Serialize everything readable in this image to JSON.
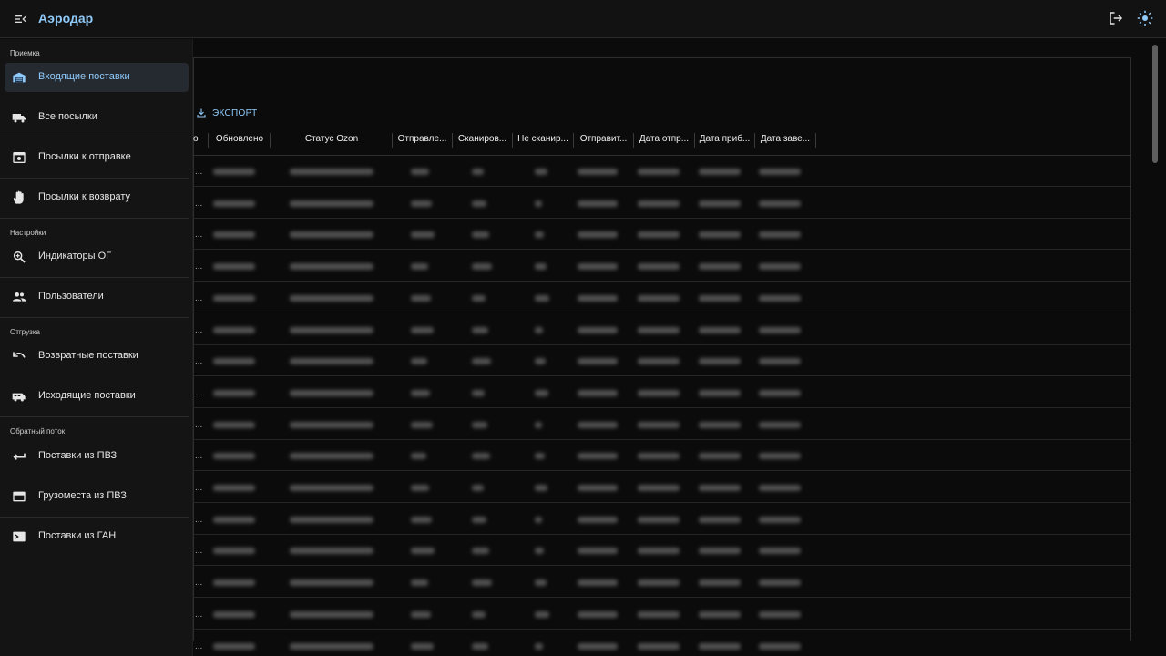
{
  "app": {
    "title": "Аэродар"
  },
  "toolbar": {
    "export_label": "ЭКСПОРТ"
  },
  "sidebar": {
    "sections": [
      {
        "title": "Приемка",
        "items": [
          {
            "label": "Входящие поставки",
            "icon": "warehouse-icon",
            "active": true
          },
          {
            "label": "Все посылки",
            "icon": "truck-icon",
            "active": false
          },
          {
            "label": "Посылки к отправке",
            "icon": "package-send-icon",
            "active": false
          },
          {
            "label": "Посылки к возврату",
            "icon": "hand-icon",
            "active": false
          }
        ]
      },
      {
        "title": "Настройки",
        "items": [
          {
            "label": "Индикаторы ОГ",
            "icon": "zoom-in-icon",
            "active": false
          },
          {
            "label": "Пользователи",
            "icon": "people-icon",
            "active": false
          }
        ]
      },
      {
        "title": "Отгрузка",
        "items": [
          {
            "label": "Возвратные поставки",
            "icon": "undo-icon",
            "active": false
          },
          {
            "label": "Исходящие поставки",
            "icon": "van-icon",
            "active": false
          }
        ]
      },
      {
        "title": "Обратный поток",
        "items": [
          {
            "label": "Поставки из ПВЗ",
            "icon": "arrow-back-icon",
            "active": false
          },
          {
            "label": "Грузоместа из ПВЗ",
            "icon": "card-icon",
            "active": false
          },
          {
            "label": "Поставки из ГАН",
            "icon": "terminal-icon",
            "active": false
          }
        ]
      }
    ]
  },
  "table": {
    "columns": [
      {
        "label": "о"
      },
      {
        "label": "Обновлено"
      },
      {
        "label": "Статус Ozon"
      },
      {
        "label": "Отправле..."
      },
      {
        "label": "Сканиров..."
      },
      {
        "label": "Не сканир..."
      },
      {
        "label": "Отправит..."
      },
      {
        "label": "Дата отпр..."
      },
      {
        "label": "Дата приб..."
      },
      {
        "label": "Дата заве..."
      }
    ],
    "row_marker": "...",
    "row_count": 16
  },
  "colors": {
    "accent": "#90caf9",
    "background": "#0b0b0b",
    "drawer": "#141414",
    "active_item": "#252a31"
  }
}
